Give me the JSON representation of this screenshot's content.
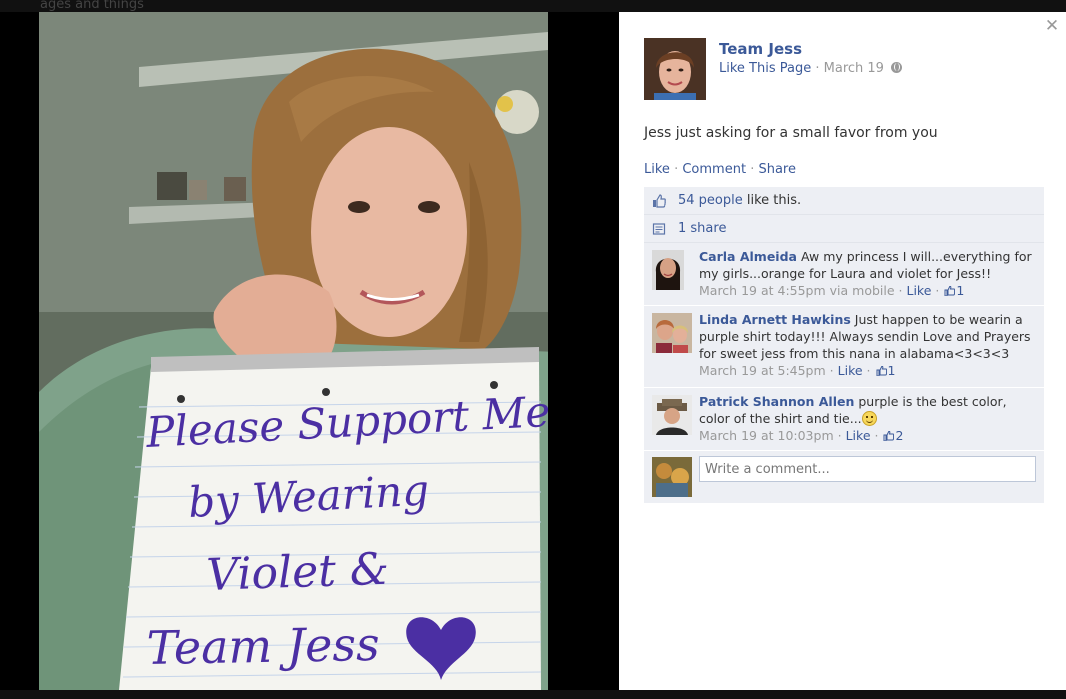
{
  "backdrop": {
    "fragment": "ages and things"
  },
  "post": {
    "page_name": "Team Jess",
    "like_page_label": "Like This Page",
    "separator": "·",
    "date": "March 19",
    "text": "Jess just asking for a small favor from you",
    "actions": {
      "like": "Like",
      "comment": "Comment",
      "share": "Share"
    }
  },
  "photo": {
    "sign_lines": [
      "Please Support Me",
      "by Wearing",
      "Violet &",
      "Team Jess"
    ],
    "sign_ink_color": "#4b2fa3"
  },
  "feedback": {
    "likes_link": "54 people",
    "likes_suffix": " like this.",
    "shares_link": "1 share"
  },
  "comments": [
    {
      "author": "Carla Almeida",
      "text": " Aw my princess I will...everything for my girls...orange for Laura and violet for Jess!!",
      "time": "March 19 at 4:55pm via mobile",
      "like_label": "Like",
      "like_count": "1"
    },
    {
      "author": "Linda Arnett Hawkins",
      "text": " Just happen to be wearin a purple shirt today!!! Always sendin Love and Prayers for sweet jess from this nana in alabama<3<3<3",
      "time": "March 19 at 5:45pm",
      "like_label": "Like",
      "like_count": "1"
    },
    {
      "author": "Patrick Shannon Allen",
      "text": " purple is the best color, color of the shirt and tie...",
      "time": "March 19 at 10:03pm",
      "like_label": "Like",
      "like_count": "2"
    }
  ],
  "compose": {
    "placeholder": "Write a comment..."
  },
  "colors": {
    "link": "#3b5998",
    "feedback_bg": "#edeff4",
    "meta": "#999999"
  },
  "icons": [
    "close-icon",
    "globe-icon",
    "like-icon",
    "share-icon",
    "smile-icon"
  ]
}
